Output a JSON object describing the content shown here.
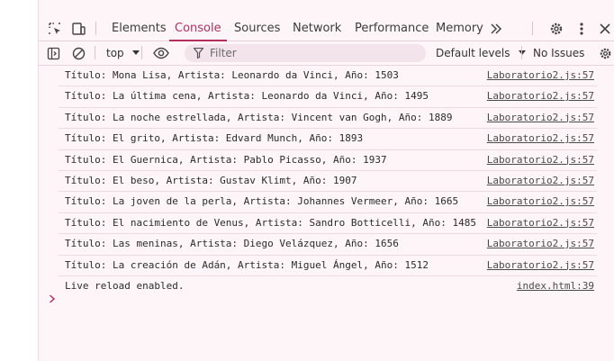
{
  "tabs": [
    {
      "label": "Elements"
    },
    {
      "label": "Console"
    },
    {
      "label": "Sources"
    },
    {
      "label": "Network"
    },
    {
      "label": "Performance"
    },
    {
      "label": "Memory"
    }
  ],
  "toolbar": {
    "context": "top",
    "filter_placeholder": "Filter",
    "levels": "Default levels",
    "issues": "No Issues"
  },
  "messages": [
    {
      "text": "Título: Mona Lisa, Artista: Leonardo da Vinci, Año: 1503",
      "source": "Laboratorio2.js:57"
    },
    {
      "text": "Título: La última cena, Artista: Leonardo da Vinci, Año: 1495",
      "source": "Laboratorio2.js:57"
    },
    {
      "text": "Título: La noche estrellada, Artista: Vincent van Gogh, Año: 1889",
      "source": "Laboratorio2.js:57"
    },
    {
      "text": "Título: El grito, Artista: Edvard Munch, Año: 1893",
      "source": "Laboratorio2.js:57"
    },
    {
      "text": "Título: El Guernica, Artista: Pablo Picasso, Año: 1937",
      "source": "Laboratorio2.js:57"
    },
    {
      "text": "Título: El beso, Artista: Gustav Klimt, Año: 1907",
      "source": "Laboratorio2.js:57"
    },
    {
      "text": "Título: La joven de la perla, Artista: Johannes Vermeer, Año: 1665",
      "source": "Laboratorio2.js:57"
    },
    {
      "text": "Título: El nacimiento de Venus, Artista: Sandro Botticelli, Año: 1485",
      "source": "Laboratorio2.js:57"
    },
    {
      "text": "Título: Las meninas, Artista: Diego Velázquez, Año: 1656",
      "source": "Laboratorio2.js:57"
    },
    {
      "text": "Título: La creación de Adán, Artista: Miguel Ángel, Año: 1512",
      "source": "Laboratorio2.js:57"
    },
    {
      "text": "Live reload enabled.",
      "source": "index.html:39"
    }
  ],
  "colors": {
    "accent": "#b3305e",
    "panel_bg": "#fdf5f8"
  }
}
